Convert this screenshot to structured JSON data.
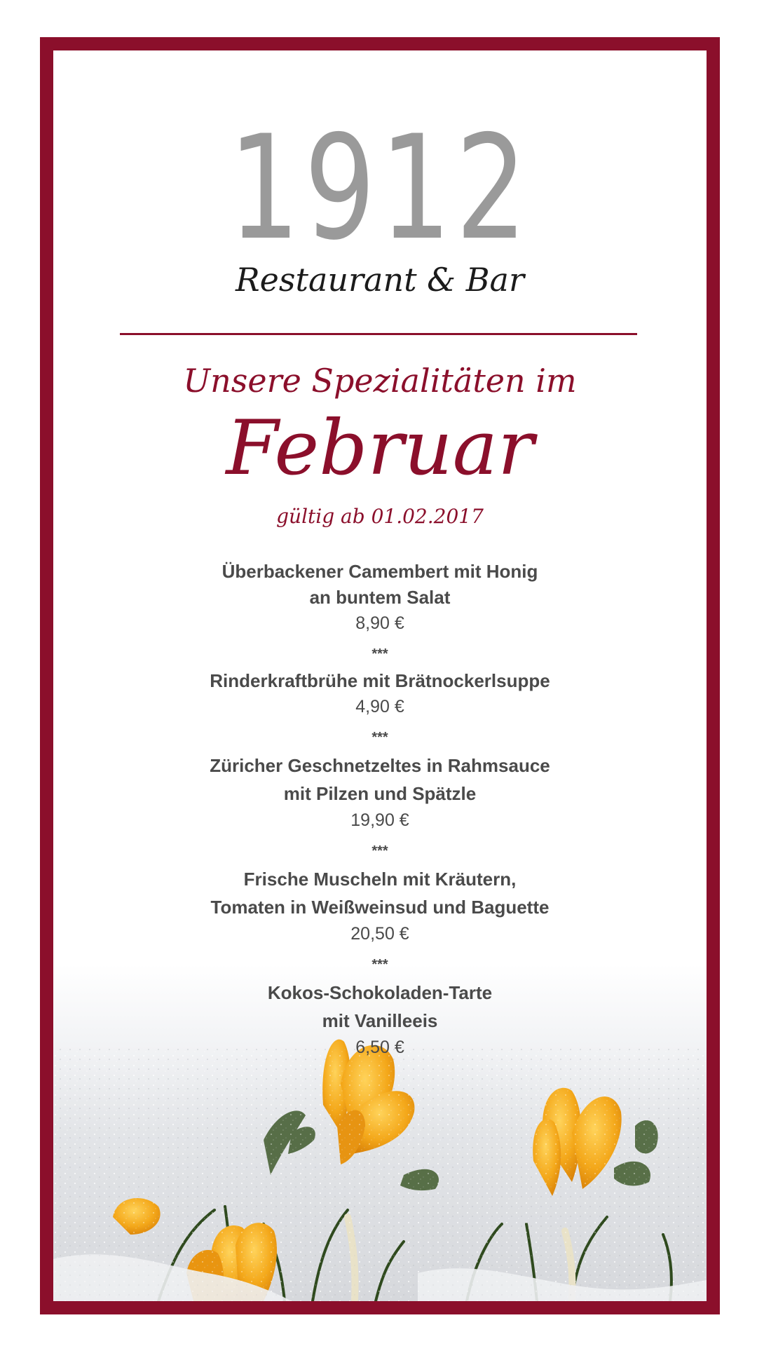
{
  "brand": {
    "number": "1912",
    "subtitle": "Restaurant & Bar"
  },
  "heading": {
    "line1": "Unsere Spezialitäten im",
    "month": "Februar",
    "validity": "gültig ab 01.02.2017"
  },
  "separator": "***",
  "dishes": [
    {
      "lines": [
        "Überbackener Camembert mit Honig",
        "an buntem Salat"
      ],
      "price": "8,90 €"
    },
    {
      "lines": [
        "Rinderkraftbrühe mit Brätnockerlsuppe"
      ],
      "price": "4,90 €"
    },
    {
      "lines": [
        "Züricher Geschnetzeltes in Rahmsauce",
        "mit Pilzen und Spätzle"
      ],
      "price": "19,90 €"
    },
    {
      "lines": [
        "Frische Muscheln mit Kräutern,",
        "Tomaten in Weißweinsud und Baguette"
      ],
      "price": "20,50 €"
    },
    {
      "lines": [
        "Kokos-Schokoladen-Tarte",
        "mit Vanilleeis"
      ],
      "price": "6,50 €"
    }
  ],
  "colors": {
    "frame": "#8b0f2b",
    "accent": "#8b0f2b",
    "logo_gray": "#9a9a9a",
    "text": "#4a4a4a",
    "crocus": "#f2a516"
  },
  "image": {
    "content": "crocus-flowers-in-snow"
  }
}
